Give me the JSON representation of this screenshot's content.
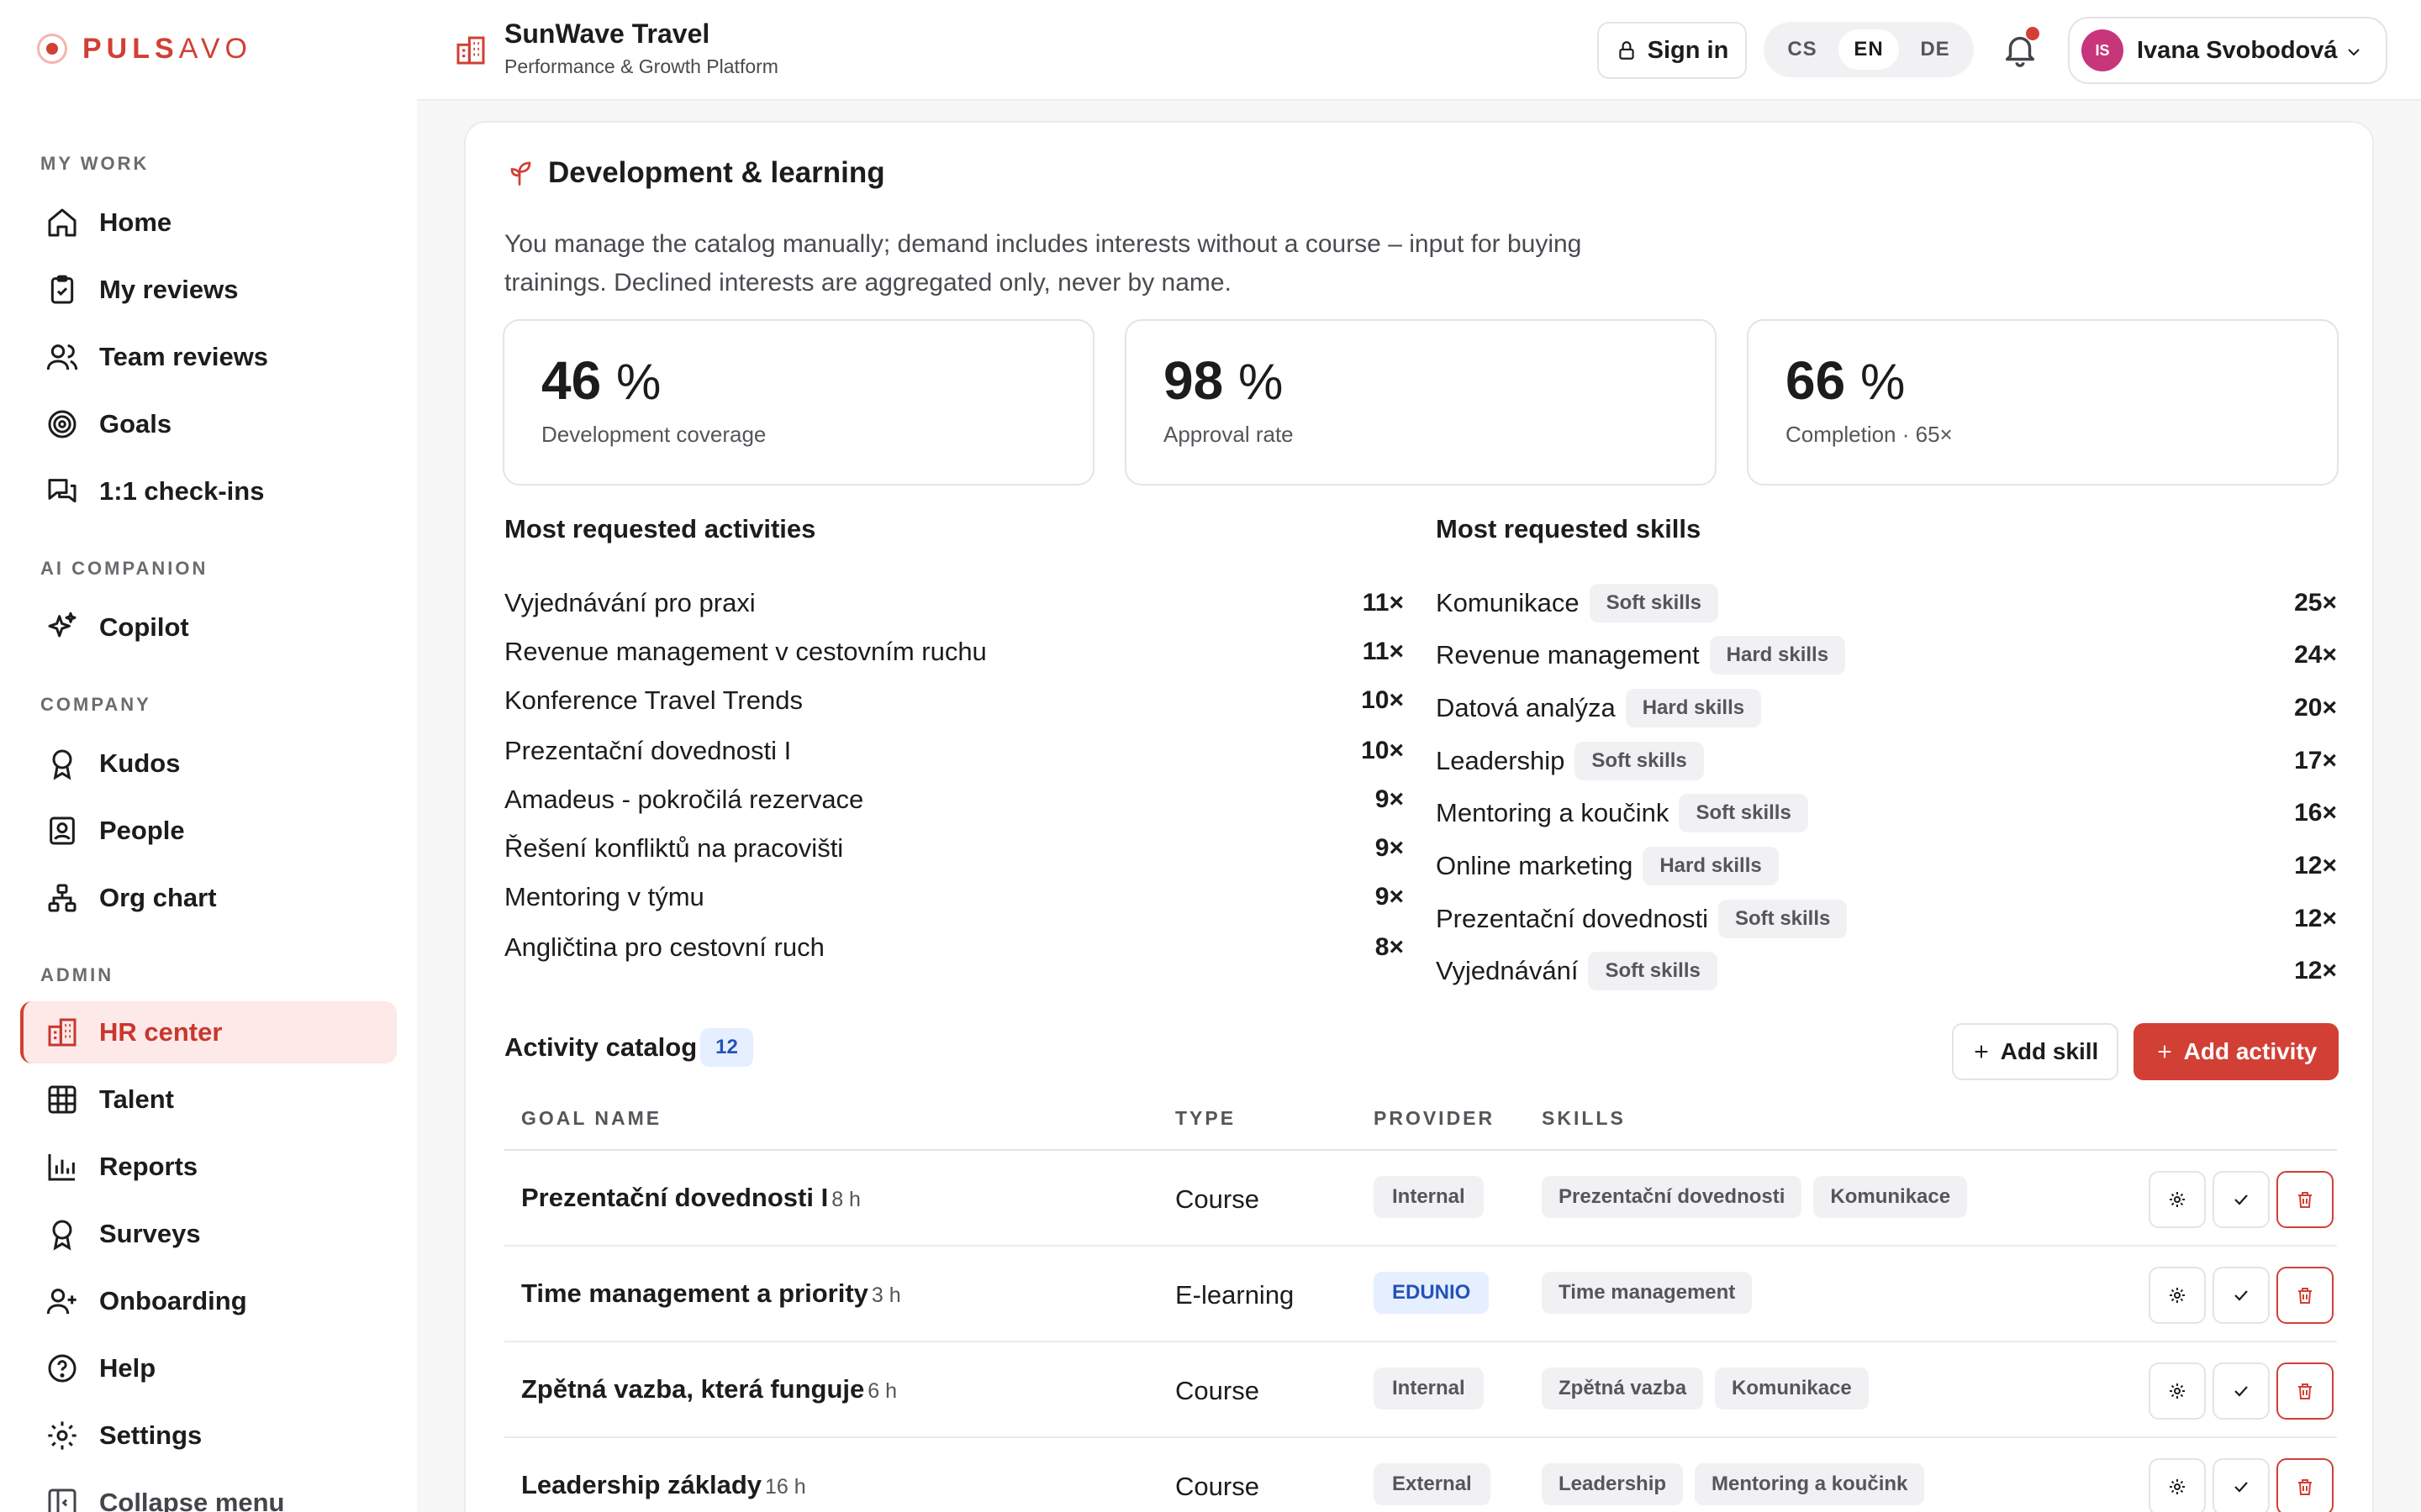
{
  "brand": {
    "name_bold": "PULS",
    "name_light": "AVO",
    "accent": "#d23f34"
  },
  "sidebar": {
    "sections": [
      {
        "title": "MY WORK"
      },
      {
        "title": "AI COMPANION"
      },
      {
        "title": "COMPANY"
      },
      {
        "title": "ADMIN"
      }
    ],
    "items": [
      {
        "label": "Home",
        "icon": "home-icon"
      },
      {
        "label": "My reviews",
        "icon": "clipboard-icon"
      },
      {
        "label": "Team reviews",
        "icon": "users-icon"
      },
      {
        "label": "Goals",
        "icon": "target-icon"
      },
      {
        "label": "1:1 check-ins",
        "icon": "chat-icon"
      },
      {
        "label": "Copilot",
        "icon": "sparkles-icon"
      },
      {
        "label": "Kudos",
        "icon": "award-icon"
      },
      {
        "label": "People",
        "icon": "contact-icon"
      },
      {
        "label": "Org chart",
        "icon": "org-chart-icon"
      },
      {
        "label": "HR center",
        "icon": "building-icon",
        "active": true
      },
      {
        "label": "Talent",
        "icon": "grid-icon"
      },
      {
        "label": "Reports",
        "icon": "bar-chart-icon"
      },
      {
        "label": "Surveys",
        "icon": "award-icon"
      },
      {
        "label": "Onboarding",
        "icon": "user-plus-icon"
      },
      {
        "label": "Help",
        "icon": "help-circle-icon"
      },
      {
        "label": "Settings",
        "icon": "gear-icon"
      },
      {
        "label": "Collapse menu",
        "icon": "collapse-icon"
      }
    ]
  },
  "header": {
    "company": "SunWave Travel",
    "subtitle": "Performance & Growth Platform",
    "sign_in": "Sign in",
    "languages": [
      "CS",
      "EN",
      "DE"
    ],
    "selected_language": "EN",
    "user": {
      "initials": "IS",
      "name": "Ivana Svobodová"
    }
  },
  "card": {
    "title": "Development & learning",
    "description": "You manage the catalog manually; demand includes interests without a course – input for buying trainings. Declined interests are aggregated only, never by name.",
    "stats": [
      {
        "value": "46",
        "unit": "%",
        "label": "Development coverage"
      },
      {
        "value": "98",
        "unit": "%",
        "label": "Approval rate"
      },
      {
        "value": "66",
        "unit": "%",
        "label": "Completion · 65×"
      }
    ],
    "activities_title": "Most requested activities",
    "activities": [
      {
        "name": "Vyjednávání pro praxi",
        "count": "11×"
      },
      {
        "name": "Revenue management v cestovním ruchu",
        "count": "11×"
      },
      {
        "name": "Konference Travel Trends",
        "count": "10×"
      },
      {
        "name": "Prezentační dovednosti I",
        "count": "10×"
      },
      {
        "name": "Amadeus - pokročilá rezervace",
        "count": "9×"
      },
      {
        "name": "Řešení konfliktů na pracovišti",
        "count": "9×"
      },
      {
        "name": "Mentoring v týmu",
        "count": "9×"
      },
      {
        "name": "Angličtina pro cestovní ruch",
        "count": "8×"
      }
    ],
    "skills_title": "Most requested skills",
    "skills": [
      {
        "name": "Komunikace",
        "tag": "Soft skills",
        "count": "25×"
      },
      {
        "name": "Revenue management",
        "tag": "Hard skills",
        "count": "24×"
      },
      {
        "name": "Datová analýza",
        "tag": "Hard skills",
        "count": "20×"
      },
      {
        "name": "Leadership",
        "tag": "Soft skills",
        "count": "17×"
      },
      {
        "name": "Mentoring a koučink",
        "tag": "Soft skills",
        "count": "16×"
      },
      {
        "name": "Online marketing",
        "tag": "Hard skills",
        "count": "12×"
      },
      {
        "name": "Prezentační dovednosti",
        "tag": "Soft skills",
        "count": "12×"
      },
      {
        "name": "Vyjednávání",
        "tag": "Soft skills",
        "count": "12×"
      }
    ],
    "catalog_title": "Activity catalog",
    "catalog_count": "12",
    "add_skill": "Add skill",
    "add_activity": "Add activity",
    "columns": [
      "GOAL NAME",
      "TYPE",
      "PROVIDER",
      "SKILLS"
    ],
    "rows": [
      {
        "name": "Prezentační dovednosti I",
        "hours": "8 h",
        "type": "Course",
        "provider": "Internal",
        "skills": [
          "Prezentační dovednosti",
          "Komunikace"
        ]
      },
      {
        "name": "Time management a priority",
        "hours": "3 h",
        "type": "E-learning",
        "provider": "EDUNIO",
        "skills": [
          "Time management"
        ]
      },
      {
        "name": "Zpětná vazba, která funguje",
        "hours": "6 h",
        "type": "Course",
        "provider": "Internal",
        "skills": [
          "Zpětná vazba",
          "Komunikace"
        ]
      },
      {
        "name": "Leadership základy",
        "hours": "16 h",
        "type": "Course",
        "provider": "External",
        "skills": [
          "Leadership",
          "Mentoring a koučink"
        ]
      }
    ]
  }
}
